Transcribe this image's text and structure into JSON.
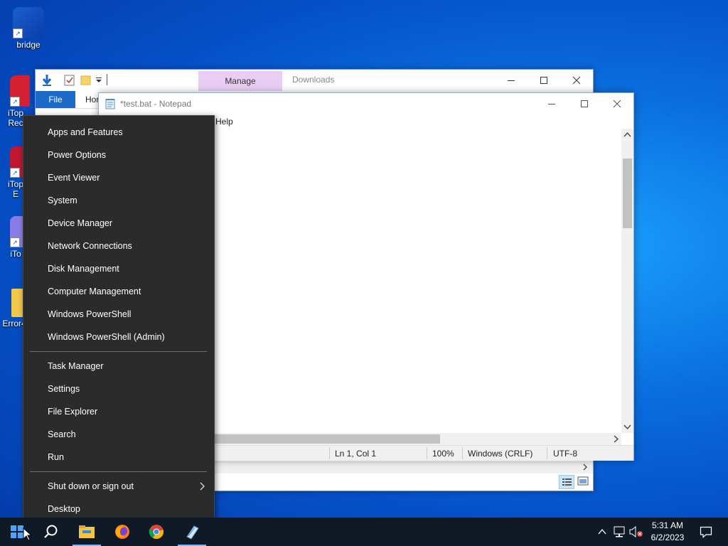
{
  "desktop": {
    "icons": [
      {
        "label": "bridge"
      },
      {
        "label": "iTop\nRec"
      },
      {
        "label": "iTop\nE"
      },
      {
        "label": "iTo"
      },
      {
        "label": "Error4"
      }
    ]
  },
  "explorer": {
    "manage_tab": "Manage",
    "location": "Downloads",
    "file_tab": "File",
    "home_tab": "Hor"
  },
  "notepad": {
    "title": "*test.bat - Notepad",
    "menu_visible": "Help",
    "status": {
      "position": "Ln 1, Col 1",
      "zoom": "100%",
      "line_ending": "Windows (CRLF)",
      "encoding": "UTF-8"
    }
  },
  "winx_menu": {
    "group1": [
      "Apps and Features",
      "Power Options",
      "Event Viewer",
      "System",
      "Device Manager",
      "Network Connections",
      "Disk Management",
      "Computer Management",
      "Windows PowerShell",
      "Windows PowerShell (Admin)"
    ],
    "group2": [
      "Task Manager",
      "Settings",
      "File Explorer",
      "Search",
      "Run"
    ],
    "group3": [
      "Shut down or sign out",
      "Desktop"
    ]
  },
  "taskbar": {
    "time": "5:31 AM",
    "date": "6/2/2023"
  },
  "colors": {
    "accent": "#1b6ac9",
    "menu_bg": "#2b2b2b",
    "taskbar_bg": "#101a26",
    "manage_highlight": "#eacdf5"
  }
}
